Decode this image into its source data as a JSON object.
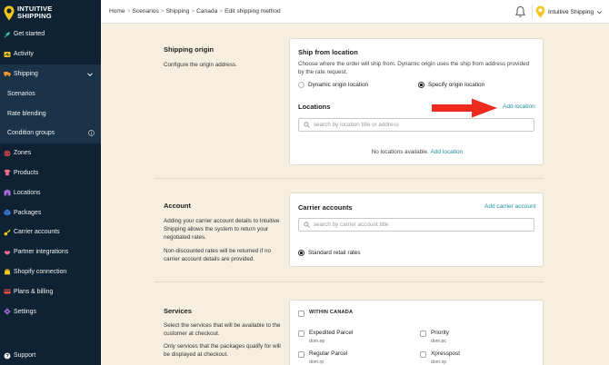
{
  "brand": {
    "line1": "INTUITIVE",
    "line2": "SHIPPING",
    "accent": "#f2c51b"
  },
  "sidebar": {
    "items": [
      {
        "label": "Get started",
        "icon": "rocket-icon"
      },
      {
        "label": "Activity",
        "icon": "activity-icon"
      },
      {
        "label": "Shipping",
        "icon": "truck-icon",
        "expanded": true
      },
      {
        "label": "Scenarios",
        "sub": true
      },
      {
        "label": "Rate blending",
        "sub": true
      },
      {
        "label": "Condition groups",
        "sub": true,
        "icon": "info-icon"
      },
      {
        "label": "Zones",
        "icon": "globe-icon"
      },
      {
        "label": "Products",
        "icon": "shirt-icon"
      },
      {
        "label": "Locations",
        "icon": "building-icon"
      },
      {
        "label": "Packages",
        "icon": "box-icon"
      },
      {
        "label": "Carrier accounts",
        "icon": "key-icon"
      },
      {
        "label": "Partner integrations",
        "icon": "partner-icon"
      },
      {
        "label": "Shopify connection",
        "icon": "shopify-icon"
      },
      {
        "label": "Plans & billing",
        "icon": "card-icon"
      },
      {
        "label": "Settings",
        "icon": "gear-icon"
      }
    ],
    "support": "Support"
  },
  "topbar": {
    "breadcrumb": [
      "Home",
      "Scenarios",
      "Shipping",
      "Canada",
      "Edit shipping method"
    ],
    "separator": ">",
    "account_name": "Intuitive Shipping"
  },
  "origin": {
    "title": "Shipping origin",
    "desc": "Configure the origin address.",
    "card_title": "Ship from location",
    "card_desc": "Choose where the order will ship from. Dynamic origin uses the ship from address provided by the rate request.",
    "radio_dynamic": "Dynamic origin location",
    "radio_specific": "Specify origin location",
    "locations_label": "Locations",
    "add_location": "Add location",
    "search_placeholder": "search by location title or address",
    "empty_text": "No locations available.",
    "empty_link": "Add location"
  },
  "account": {
    "title": "Account",
    "desc1": "Adding your carrier account details to Intuitive Shipping allows the system to return your negotiated rates.",
    "desc2": "Non-discounted rates will be returned if no carrier account details are provided.",
    "card_title": "Carrier accounts",
    "add_link": "Add carrier account",
    "search_placeholder": "search by carrier account title",
    "radio_standard": "Standard retail rates"
  },
  "services": {
    "title": "Services",
    "desc1": "Select the services that will be available to the customer at checkout.",
    "desc2": "Only services that the packages qualify for will be displayed at checkout.",
    "group_label": "WITHIN CANADA",
    "items": [
      {
        "label": "Expedited Parcel",
        "code": "dom.ep"
      },
      {
        "label": "Priority",
        "code": "dom.pc"
      },
      {
        "label": "Regular Parcel",
        "code": "dom.rp"
      },
      {
        "label": "Xpresspost",
        "code": "dom.xp"
      }
    ]
  },
  "annotation": {
    "arrow_color": "#ef2a1f"
  }
}
